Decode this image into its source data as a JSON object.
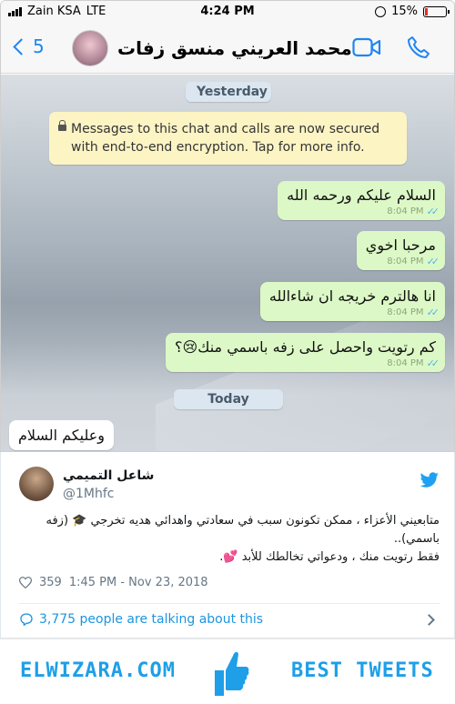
{
  "status_bar": {
    "carrier": "Zain KSA",
    "network": "LTE",
    "time": "4:24 PM",
    "battery_percent": "15%",
    "battery_level": 0.15
  },
  "chat_header": {
    "back_count": "5",
    "contact_name": "محمد العريني منسق زفات",
    "icons": [
      "chevron-left-icon",
      "video-call-icon",
      "phone-call-icon"
    ]
  },
  "chat": {
    "date_yesterday": "Yesterday",
    "security_notice": "Messages to this chat and calls are now secured with end-to-end encryption. Tap for more info.",
    "outgoing": [
      {
        "text": "السلام عليكم ورحمه الله",
        "time": "8:04 PM"
      },
      {
        "text": "مرحبا اخوي",
        "time": "8:04 PM"
      },
      {
        "text": "انا هالترم خريجه ان شاءالله",
        "time": "8:04 PM"
      },
      {
        "text": "كم رتويت واحصل على زفه باسمي منك😢؟",
        "time": "8:04 PM"
      }
    ],
    "date_today": "Today",
    "incoming": [
      {
        "text": "وعليكم السلام"
      }
    ]
  },
  "tweet": {
    "author_name": "شاعل التميمي",
    "author_handle": "@1Mhfc",
    "text_line1": "متابعيني الأعزاء ، ممكن تكونون سبب في سعادتي واهدائي هديه تخرجي 🎓 (زفه باسمي)..",
    "text_line2": "فقط رتويت منك ، ودعواتي تخالطك للأبد 💕.",
    "likes": "359",
    "timestamp": "1:45 PM - Nov 23, 2018",
    "talking": "3,775 people are talking about this"
  },
  "banner": {
    "left_text": "ELWIZARA.COM",
    "right_text": "BEST TWEETS"
  },
  "colors": {
    "whatsapp_blue": "#1f86f2",
    "outgoing_bubble": "#dcf8c6",
    "twitter_blue": "#1b95e0",
    "banner_blue": "#1e9fe8"
  }
}
